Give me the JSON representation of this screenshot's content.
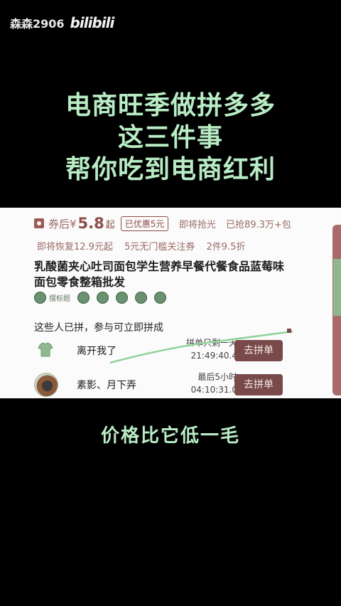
{
  "watermark": {
    "user": "森森2906",
    "logo": "bilibili"
  },
  "headline": {
    "line1": "电商旺季做拼多多",
    "line2": "这三件事",
    "line3": "帮你吃到电商红利"
  },
  "product": {
    "price_label": "券后¥",
    "price_value": "5.8",
    "price_suffix": "起",
    "discount_badge": "已优惠5元",
    "sold_status": "即将抢光",
    "sold_count": "已抢89.3万+包",
    "promo_restore": "即将恢复12.9元起",
    "promo_nodoor": "5元无门槛关注券",
    "promo_discount": "2件9.5折",
    "title": "乳酸菌夹心吐司面包学生营养早餐代餐食品蓝莓味面包零食整箱批发",
    "tag_text": "摆标题"
  },
  "groups": {
    "hint": "这些人已拼，参与可立即拼成",
    "items": [
      {
        "name": "离开我了",
        "time_label": "拼单只剩一天",
        "time_value": "21:49:40.4",
        "button": "去拼单"
      },
      {
        "name": "素影、月下弄",
        "time_label": "最后5小时",
        "time_value": "04:10:31.0",
        "button": "去拼单"
      }
    ]
  },
  "caption": "价格比它低一毛",
  "colors": {
    "accent": "#b8ecc4",
    "brand": "#7a4a4a"
  }
}
